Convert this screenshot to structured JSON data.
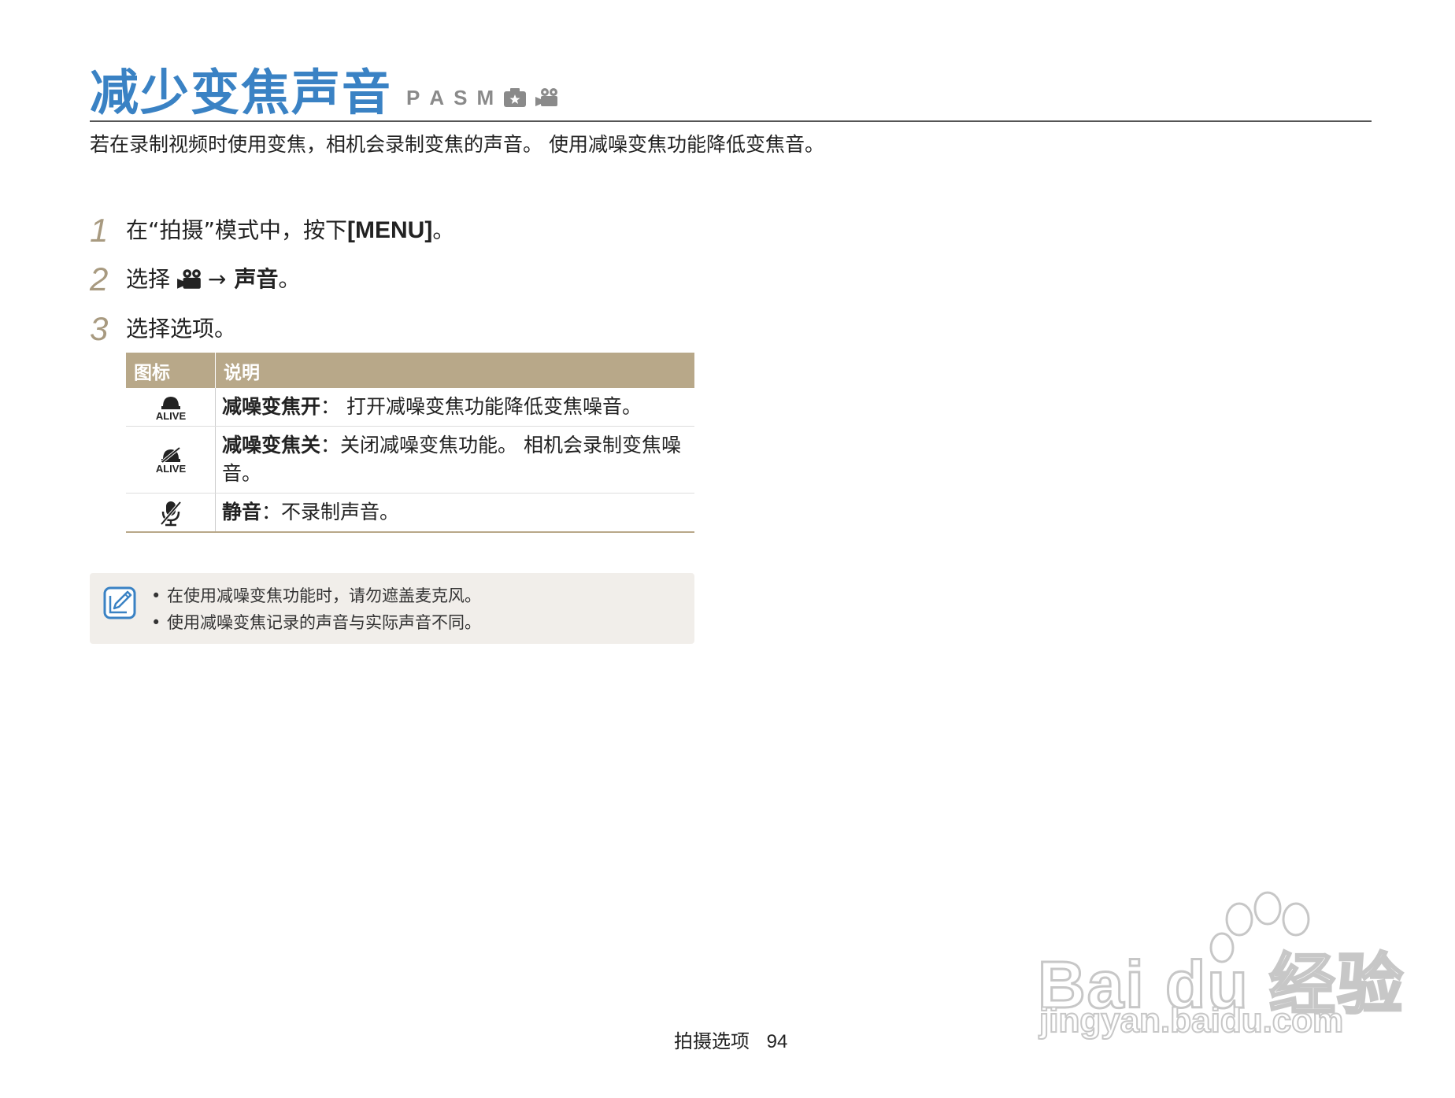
{
  "header": {
    "title": "减少变焦声音",
    "modes": [
      "P",
      "A",
      "S",
      "M"
    ],
    "mode_icons": [
      "scene-camera-icon",
      "movie-camera-icon"
    ]
  },
  "intro": "若在录制视频时使用变焦，相机会录制变焦的声音。 使用减噪变焦功能降低变焦音。",
  "steps": [
    {
      "num": "1",
      "text_before": "在“拍摄”模式中，按下 ",
      "key": "[MENU]",
      "text_after": "。"
    },
    {
      "num": "2",
      "text_before": "选择",
      "icon": "movie-camera-icon",
      "arrow": "→",
      "bold_text": "声音",
      "text_after": "。"
    },
    {
      "num": "3",
      "text": "选择选项。"
    }
  ],
  "table": {
    "headers": [
      "图标",
      "说明"
    ],
    "rows": [
      {
        "icon": "alive-mic-on-icon",
        "name": "减噪变焦开",
        "desc": "： 打开减噪变焦功能降低变焦噪音。"
      },
      {
        "icon": "alive-mic-off-icon",
        "name": "减噪变焦关",
        "desc": "：关闭减噪变焦功能。 相机会录制变焦噪音。"
      },
      {
        "icon": "mute-mic-icon",
        "name": "静音",
        "desc": "：不录制声音。"
      }
    ]
  },
  "notes": [
    "在使用减噪变焦功能时，请勿遮盖麦克风。",
    "使用减噪变焦记录的声音与实际声音不同。"
  ],
  "footer": {
    "section": "拍摄选项",
    "page": "94"
  },
  "watermark": {
    "brand": "Bai du 经验",
    "url": "jingyan.baidu.com"
  },
  "colors": {
    "title": "#3a82c4",
    "table_header": "#b8a889",
    "step_number": "#a89a80",
    "note_bg": "#f1eeea"
  }
}
